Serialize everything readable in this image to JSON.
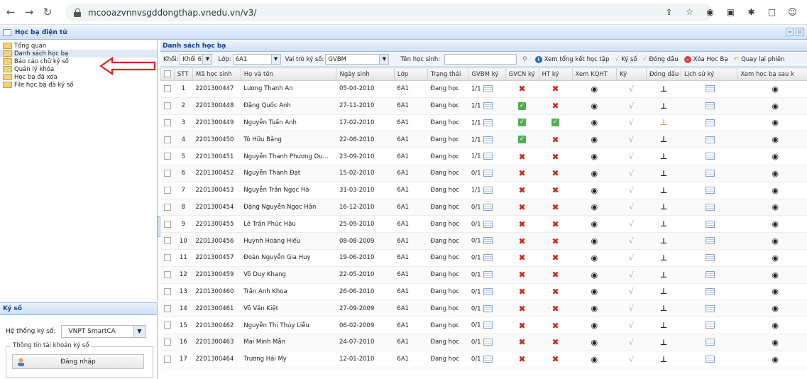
{
  "browser": {
    "url": "mcooazvnnvsgddongthap.vnedu.vn/v3/",
    "icons": [
      "back-icon",
      "forward-icon",
      "reload-icon",
      "lock-icon",
      "share-icon",
      "star-icon",
      "extension-icon",
      "puzzle-icon",
      "sidebar-icon",
      "profile-icon"
    ]
  },
  "app": {
    "title": "Học bạ điện tử"
  },
  "tree": {
    "items": [
      {
        "label": "Tổng quan",
        "selected": false
      },
      {
        "label": "Danh sách học bạ",
        "selected": true
      },
      {
        "label": "Báo cáo chữ ký số",
        "selected": false
      },
      {
        "label": "Quản lý khóa",
        "selected": false
      },
      {
        "label": "Học bạ đã xóa",
        "selected": false
      },
      {
        "label": "File học bạ đã ký số",
        "selected": false
      }
    ]
  },
  "kyso": {
    "title": "Ký số",
    "system_label": "Hệ thống ký số:",
    "system_value": "VNPT SmartCA",
    "account_legend": "Thông tin tài khoản ký số",
    "login_label": "Đăng nhập"
  },
  "main": {
    "title": "Danh sách học bạ",
    "toolbar": {
      "khoi_label": "Khối:",
      "khoi_value": "Khối 6",
      "lop_label": "Lớp:",
      "lop_value": "6A1",
      "vaitro_label": "Vai trò ký số:",
      "vaitro_value": "GVBM",
      "tenhs_label": "Tên học sinh:",
      "xem_tong_ket": "Xem tổng kết học tập",
      "ky_so": "Ký số",
      "dong_dau": "Đóng dấu",
      "xoa_hoc_ba": "Xóa Học Bạ",
      "quay_lai": "Quay lại phiên"
    },
    "columns": [
      "STT",
      "Mã học sinh",
      "Họ và tên",
      "Ngày sinh",
      "Lớp",
      "Trạng thái",
      "GVBM ký",
      "GVCN ký",
      "HT ký",
      "Xem KQHT",
      "Ký",
      "Đóng dấu",
      "Lịch sử ký",
      "Xem học bạ sau k"
    ],
    "rows": [
      {
        "stt": "1",
        "ma": "2201300447",
        "ten": "Lương Thanh An",
        "ngay": "05-04-2010",
        "lop": "6A1",
        "tt": "Đang học",
        "gvbm": "1/1",
        "gvcn": "x",
        "ht": "x",
        "stamp": "black"
      },
      {
        "stt": "2",
        "ma": "2201300448",
        "ten": "Đặng Quốc Anh",
        "ngay": "27-11-2010",
        "lop": "6A1",
        "tt": "Đang học",
        "gvbm": "1/1",
        "gvcn": "check",
        "ht": "x",
        "stamp": "black"
      },
      {
        "stt": "3",
        "ma": "2201300449",
        "ten": "Nguyễn Tuấn Anh",
        "ngay": "17-02-2010",
        "lop": "6A1",
        "tt": "Đang học",
        "gvbm": "1/1",
        "gvcn": "check",
        "ht": "check",
        "stamp": "gold"
      },
      {
        "stt": "4",
        "ma": "2201300450",
        "ten": "Tô Hữu Bằng",
        "ngay": "22-08-2010",
        "lop": "6A1",
        "tt": "Đang học",
        "gvbm": "1/1",
        "gvcn": "check",
        "ht": "x",
        "stamp": "black"
      },
      {
        "stt": "5",
        "ma": "2201300451",
        "ten": "Nguyễn Thanh Phương Du...",
        "ngay": "23-09-2010",
        "lop": "6A1",
        "tt": "Đang học",
        "gvbm": "1/1",
        "gvcn": "x",
        "ht": "x",
        "stamp": "black"
      },
      {
        "stt": "6",
        "ma": "2201300452",
        "ten": "Nguyễn Thành Đạt",
        "ngay": "15-02-2010",
        "lop": "6A1",
        "tt": "Đang học",
        "gvbm": "0/1",
        "gvcn": "x",
        "ht": "x",
        "stamp": "black"
      },
      {
        "stt": "7",
        "ma": "2201300453",
        "ten": "Nguyễn Trần Ngọc Hà",
        "ngay": "31-03-2010",
        "lop": "6A1",
        "tt": "Đang học",
        "gvbm": "1/1",
        "gvcn": "x",
        "ht": "x",
        "stamp": "black"
      },
      {
        "stt": "8",
        "ma": "2201300454",
        "ten": "Đặng Nguyễn Ngọc Hân",
        "ngay": "16-12-2010",
        "lop": "6A1",
        "tt": "Đang học",
        "gvbm": "0/1",
        "gvcn": "x",
        "ht": "x",
        "stamp": "black"
      },
      {
        "stt": "9",
        "ma": "2201300455",
        "ten": "Lê Trần Phúc Hậu",
        "ngay": "25-09-2010",
        "lop": "6A1",
        "tt": "Đang học",
        "gvbm": "0/1",
        "gvcn": "x",
        "ht": "x",
        "stamp": "black"
      },
      {
        "stt": "10",
        "ma": "2201300456",
        "ten": "Huỳnh Hoàng Hiếu",
        "ngay": "08-08-2009",
        "lop": "6A1",
        "tt": "Đang học",
        "gvbm": "0/1",
        "gvcn": "x",
        "ht": "x",
        "stamp": "black"
      },
      {
        "stt": "11",
        "ma": "2201300457",
        "ten": "Đoàn Nguyễn Gia Huy",
        "ngay": "19-06-2010",
        "lop": "6A1",
        "tt": "Đang học",
        "gvbm": "0/1",
        "gvcn": "x",
        "ht": "x",
        "stamp": "black"
      },
      {
        "stt": "12",
        "ma": "2201300459",
        "ten": "Võ Duy Khang",
        "ngay": "22-05-2010",
        "lop": "6A1",
        "tt": "Đang học",
        "gvbm": "0/1",
        "gvcn": "x",
        "ht": "x",
        "stamp": "black"
      },
      {
        "stt": "13",
        "ma": "2201300460",
        "ten": "Trần Anh Khoa",
        "ngay": "26-06-2010",
        "lop": "6A1",
        "tt": "Đang học",
        "gvbm": "0/1",
        "gvcn": "x",
        "ht": "x",
        "stamp": "black"
      },
      {
        "stt": "14",
        "ma": "2201300461",
        "ten": "Võ Văn Kiệt",
        "ngay": "27-09-2009",
        "lop": "6A1",
        "tt": "Đang học",
        "gvbm": "0/1",
        "gvcn": "x",
        "ht": "x",
        "stamp": "black"
      },
      {
        "stt": "15",
        "ma": "2201300462",
        "ten": "Nguyễn Thị Thúy Liễu",
        "ngay": "06-02-2009",
        "lop": "6A1",
        "tt": "Đang học",
        "gvbm": "0/1",
        "gvcn": "x",
        "ht": "x",
        "stamp": "black"
      },
      {
        "stt": "16",
        "ma": "2201300463",
        "ten": "Mai Minh Mẫn",
        "ngay": "24-07-2010",
        "lop": "6A1",
        "tt": "Đang học",
        "gvbm": "0/1",
        "gvcn": "x",
        "ht": "x",
        "stamp": "black"
      },
      {
        "stt": "17",
        "ma": "2201300464",
        "ten": "Trương Hải My",
        "ngay": "12-01-2010",
        "lop": "6A1",
        "tt": "Đang học",
        "gvbm": "0/1",
        "gvcn": "x",
        "ht": "x",
        "stamp": "black"
      }
    ]
  },
  "colors": {
    "header_blue": "#15428b",
    "annotation_red": "#e02020",
    "x_red": "#c62a1a",
    "check_green": "#4caf50"
  }
}
